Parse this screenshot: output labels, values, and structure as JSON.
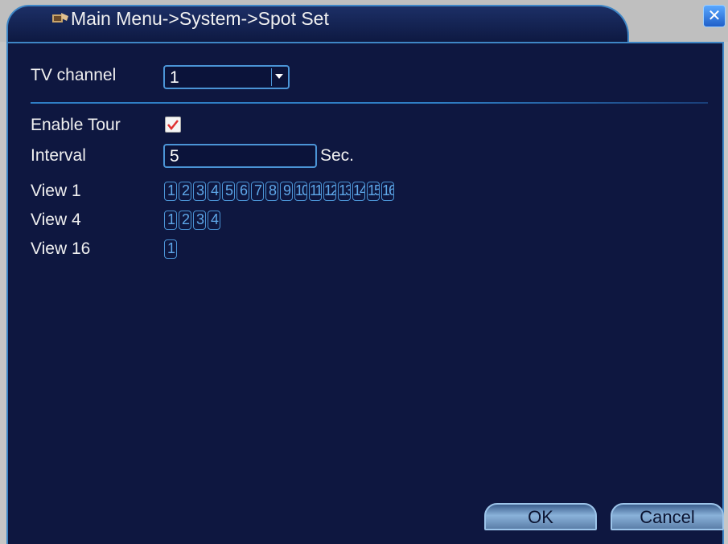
{
  "title": "Main Menu->System->Spot Set",
  "close_icon": "close-icon",
  "tv_channel": {
    "label": "TV channel",
    "value": "1"
  },
  "enable_tour": {
    "label": "Enable Tour",
    "checked": true
  },
  "interval": {
    "label": "Interval",
    "value": "5",
    "unit": "Sec."
  },
  "view1": {
    "label": "View 1",
    "channels": [
      "1",
      "2",
      "3",
      "4",
      "5",
      "6",
      "7",
      "8",
      "9",
      "10",
      "11",
      "12",
      "13",
      "14",
      "15",
      "16"
    ]
  },
  "view4": {
    "label": "View 4",
    "channels": [
      "1",
      "2",
      "3",
      "4"
    ]
  },
  "view16": {
    "label": "View 16",
    "channels": [
      "1"
    ]
  },
  "buttons": {
    "ok": "OK",
    "cancel": "Cancel"
  },
  "colors": {
    "panel": "#0e1740",
    "accent": "#4b94d6",
    "check": "#e03030"
  }
}
